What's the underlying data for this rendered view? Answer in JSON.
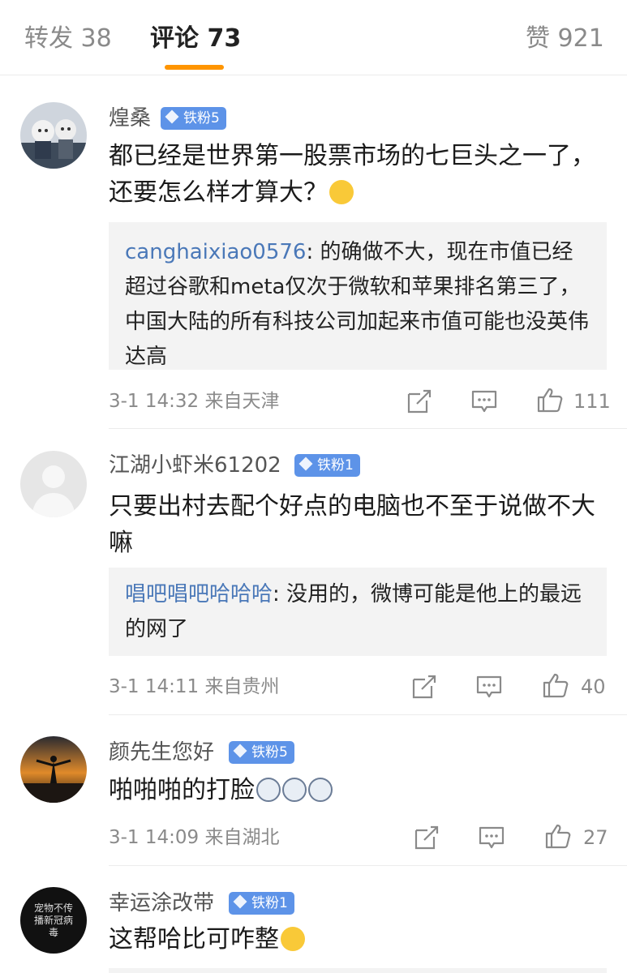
{
  "tabs": {
    "repost": "转发 38",
    "comments": "评论 73",
    "likes": "赞 921"
  },
  "comments": [
    {
      "username": "煌桑",
      "badge": "铁粉5",
      "text": "都已经是世界第一股票市场的七巨头之一了，还要怎么样才算大？",
      "reply_user": "canghaixiao0576",
      "reply_text": ": 的确做不大，现在市值已经超过谷歌和meta仅次于微软和苹果排名第三了，中国大陆的所有科技公司加起来市值可能也没英伟达高",
      "time_location": "3-1 14:32  来自天津",
      "likes": "111"
    },
    {
      "username": "江湖小虾米61202",
      "badge": "铁粉1",
      "text": "只要出村去配个好点的电脑也不至于说做不大嘛",
      "reply_user": "唱吧唱吧哈哈哈",
      "reply_text": ": 没用的，微博可能是他上的最远的网了",
      "time_location": "3-1 14:11  来自贵州",
      "likes": "40"
    },
    {
      "username": "颜先生您好",
      "badge": "铁粉5",
      "text": "啪啪啪的打脸",
      "time_location": "3-1 14:09  来自湖北",
      "likes": "27"
    },
    {
      "username": "幸运涂改带",
      "badge": "铁粉1",
      "text": "这帮哈比可咋整",
      "avatar_text": "宠物不传播新冠病毒"
    }
  ],
  "colors": {
    "accent": "#ff9500",
    "badge": "#5d93e8",
    "link": "#4a78b8"
  }
}
